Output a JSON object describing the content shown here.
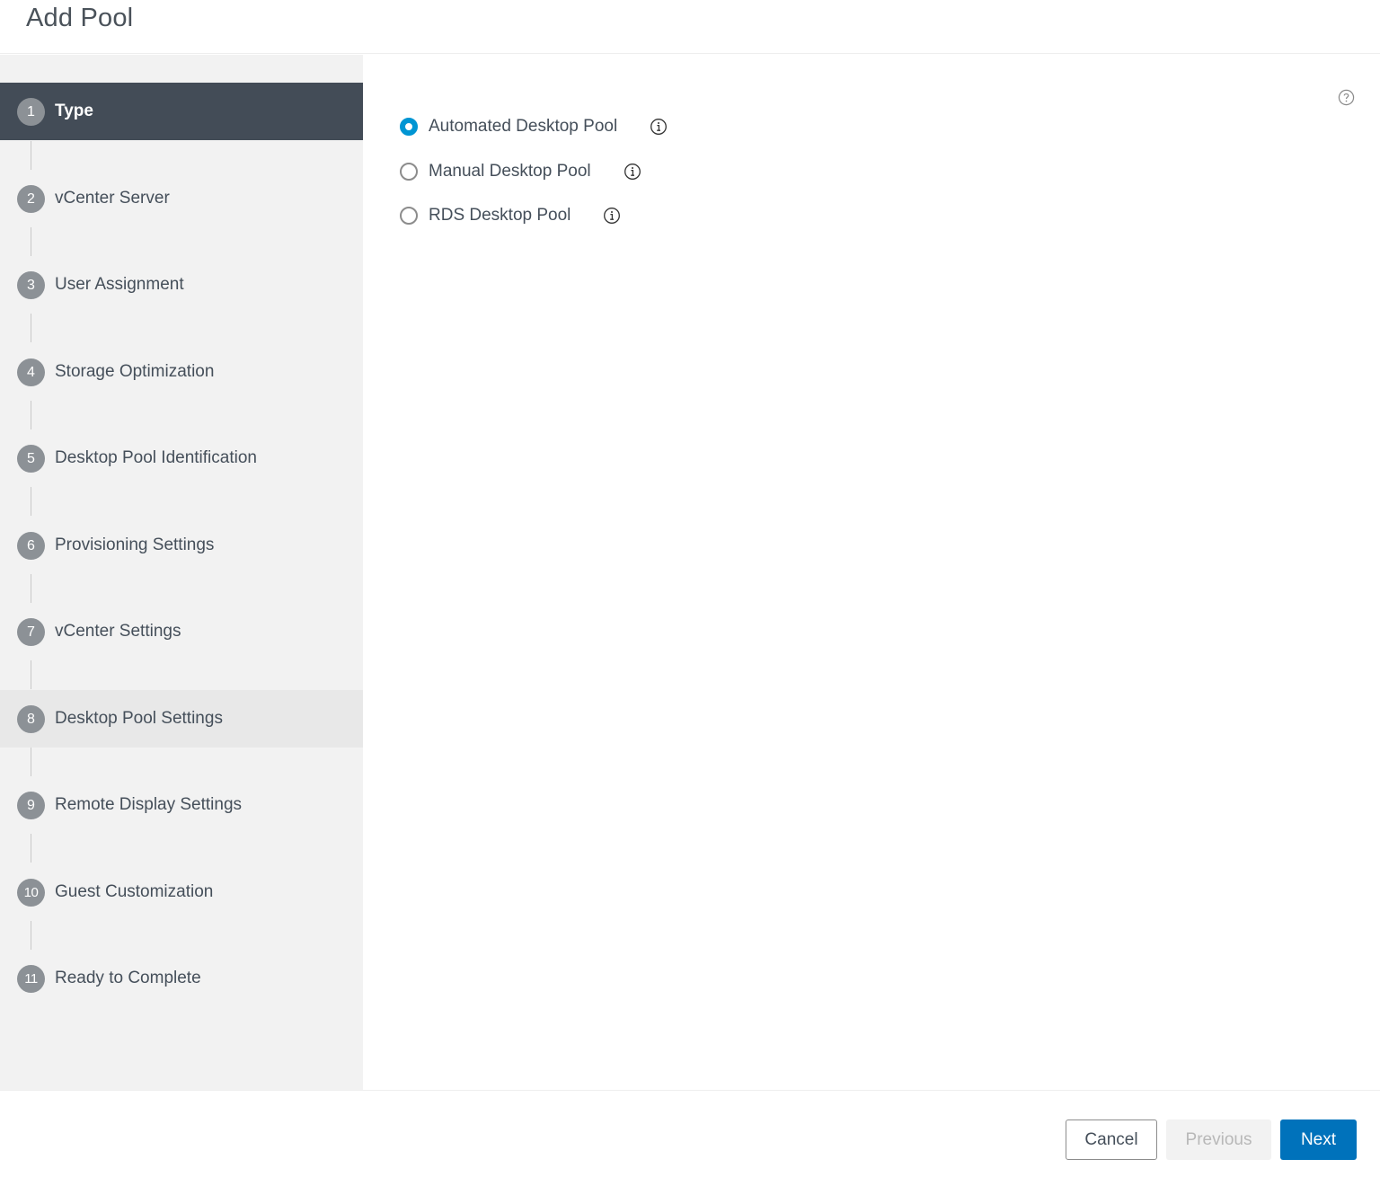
{
  "header": {
    "title": "Add Pool"
  },
  "wizard": {
    "steps": [
      {
        "number": "1",
        "label": "Type",
        "state": "active"
      },
      {
        "number": "2",
        "label": "vCenter Server",
        "state": "default"
      },
      {
        "number": "3",
        "label": "User Assignment",
        "state": "default"
      },
      {
        "number": "4",
        "label": "Storage Optimization",
        "state": "default"
      },
      {
        "number": "5",
        "label": "Desktop Pool Identification",
        "state": "default"
      },
      {
        "number": "6",
        "label": "Provisioning Settings",
        "state": "default"
      },
      {
        "number": "7",
        "label": "vCenter Settings",
        "state": "default"
      },
      {
        "number": "8",
        "label": "Desktop Pool Settings",
        "state": "hover"
      },
      {
        "number": "9",
        "label": "Remote Display Settings",
        "state": "default"
      },
      {
        "number": "10",
        "label": "Guest Customization",
        "state": "default"
      },
      {
        "number": "11",
        "label": "Ready to Complete",
        "state": "default"
      }
    ]
  },
  "main": {
    "help_icon": "help-circle-icon",
    "pool_types": [
      {
        "label": "Automated Desktop Pool",
        "selected": true,
        "icon": "info-icon"
      },
      {
        "label": "Manual Desktop Pool",
        "selected": false,
        "icon": "info-icon"
      },
      {
        "label": "RDS Desktop Pool",
        "selected": false,
        "icon": "info-icon"
      }
    ]
  },
  "footer": {
    "cancel_label": "Cancel",
    "previous_label": "Previous",
    "previous_disabled": true,
    "next_label": "Next"
  },
  "colors": {
    "active_step_bg": "#434c57",
    "accent_blue": "#0072bb",
    "radio_selected": "#0095d3",
    "sidebar_bg": "#f2f2f2"
  }
}
